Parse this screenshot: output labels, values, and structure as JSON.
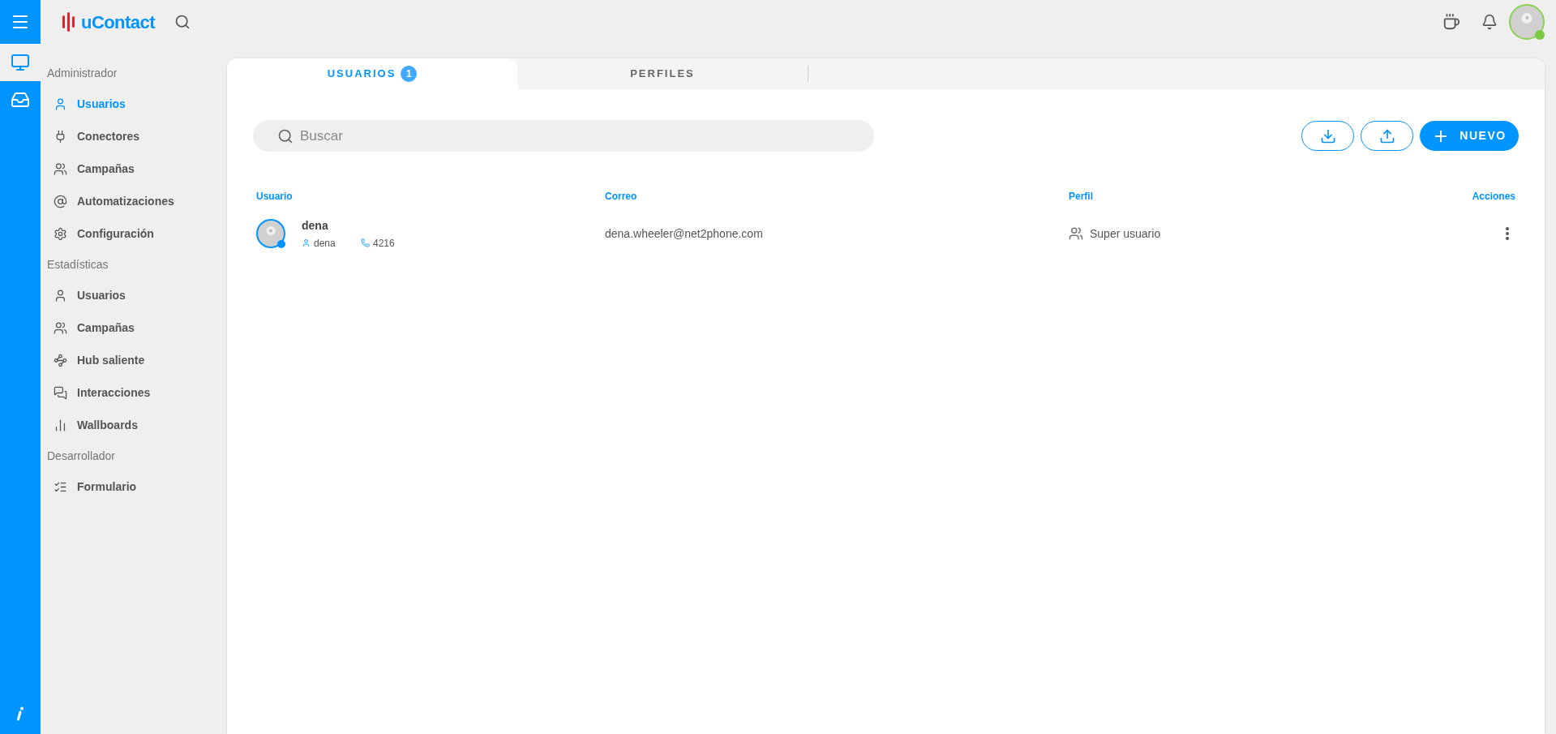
{
  "header": {
    "brand": "uContact"
  },
  "rail": {
    "items": [
      {
        "selected": true
      },
      {
        "selected": false
      }
    ]
  },
  "sidebar": {
    "sections": [
      {
        "title": "Administrador",
        "items": [
          {
            "label": "Usuarios",
            "selected": true
          },
          {
            "label": "Conectores",
            "selected": false
          },
          {
            "label": "Campañas",
            "selected": false
          },
          {
            "label": "Automatizaciones",
            "selected": false
          },
          {
            "label": "Configuración",
            "selected": false
          }
        ]
      },
      {
        "title": "Estadísticas",
        "items": [
          {
            "label": "Usuarios",
            "selected": false
          },
          {
            "label": "Campañas",
            "selected": false
          },
          {
            "label": "Hub saliente",
            "selected": false
          },
          {
            "label": "Interacciones",
            "selected": false
          },
          {
            "label": "Wallboards",
            "selected": false
          }
        ]
      },
      {
        "title": "Desarrollador",
        "items": [
          {
            "label": "Formulario",
            "selected": false
          }
        ]
      }
    ]
  },
  "tabs": [
    {
      "label": "USUARIOS",
      "badge": "1",
      "selected": true
    },
    {
      "label": "PERFILES",
      "selected": false
    }
  ],
  "search": {
    "placeholder": "Buscar"
  },
  "new_button": {
    "label": "NUEVO"
  },
  "table": {
    "columns": [
      "Usuario",
      "Correo",
      "Perfil",
      "Acciones"
    ],
    "rows": [
      {
        "name": "dena",
        "username": "dena",
        "extension": "4216",
        "email": "dena.wheeler@net2phone.com",
        "profile": "Super usuario"
      }
    ]
  }
}
